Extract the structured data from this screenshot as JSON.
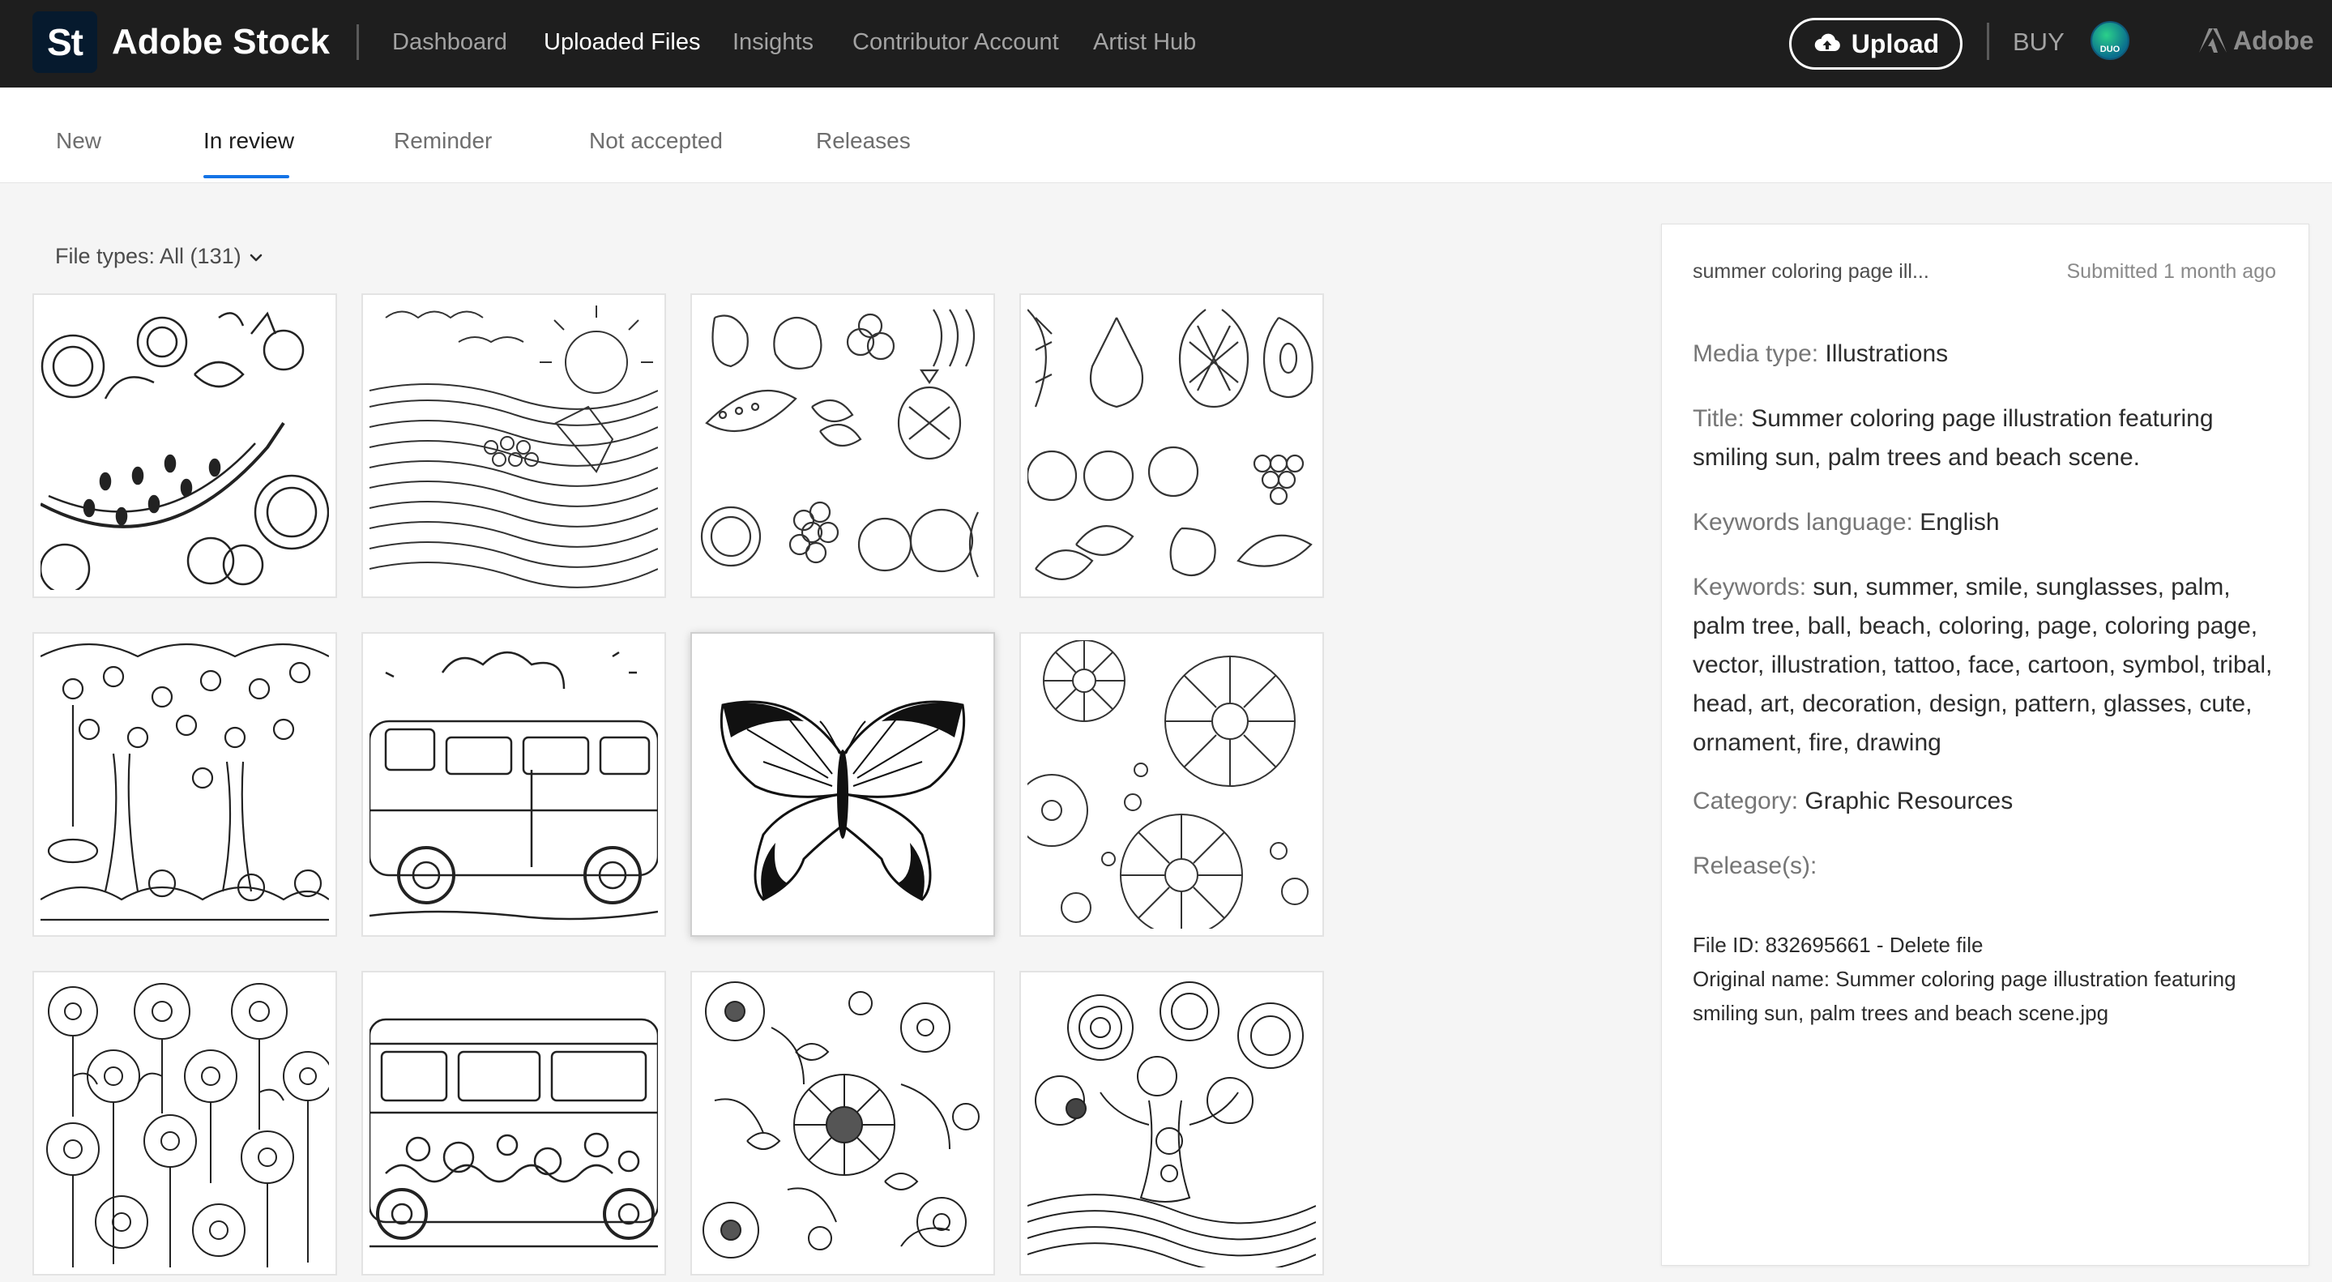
{
  "header": {
    "logo_text": "St",
    "brand": "Adobe Stock",
    "nav": [
      "Dashboard",
      "Uploaded Files",
      "Insights",
      "Contributor Account",
      "Artist Hub"
    ],
    "active_nav": "Uploaded Files",
    "upload_label": "Upload",
    "buy_label": "BUY",
    "avatar_text": "DUO",
    "adobe_label": "Adobe"
  },
  "tabs": {
    "items": [
      "New",
      "In review",
      "Reminder",
      "Not accepted",
      "Releases"
    ],
    "active": "In review"
  },
  "filter": {
    "label": "File types: All (131)"
  },
  "thumbnails": [
    {
      "subject": "fruit-mandala"
    },
    {
      "subject": "sunrise-landscape"
    },
    {
      "subject": "fruit-pattern"
    },
    {
      "subject": "fruit-collection"
    },
    {
      "subject": "fruit-trees"
    },
    {
      "subject": "camper-van"
    },
    {
      "subject": "butterfly",
      "selected": true
    },
    {
      "subject": "daisy-pattern"
    },
    {
      "subject": "daisy-field"
    },
    {
      "subject": "decorated-van"
    },
    {
      "subject": "sunflower-pattern"
    },
    {
      "subject": "mandala-tree"
    }
  ],
  "details": {
    "short_title": "summer coloring page ill...",
    "submitted": "Submitted 1 month ago",
    "media_type_label": "Media type:",
    "media_type": "Illustrations",
    "title_label": "Title:",
    "title": "Summer coloring page illustration featuring smiling sun, palm trees and beach scene.",
    "keywords_language_label": "Keywords language:",
    "keywords_language": "English",
    "keywords_label": "Keywords:",
    "keywords": "sun, summer, smile, sunglasses, palm, palm tree, ball, beach, coloring, page, coloring page, vector, illustration, tattoo, face, cartoon, symbol, tribal, head, art, decoration, design, pattern, glasses, cute, ornament, fire, drawing",
    "category_label": "Category:",
    "category": "Graphic Resources",
    "releases_label": "Release(s):",
    "file_id_label": "File ID: 832695661 - ",
    "delete_label": "Delete file",
    "original_name": "Original name: Summer coloring page illustration featuring smiling sun, palm trees and beach scene.jpg"
  }
}
